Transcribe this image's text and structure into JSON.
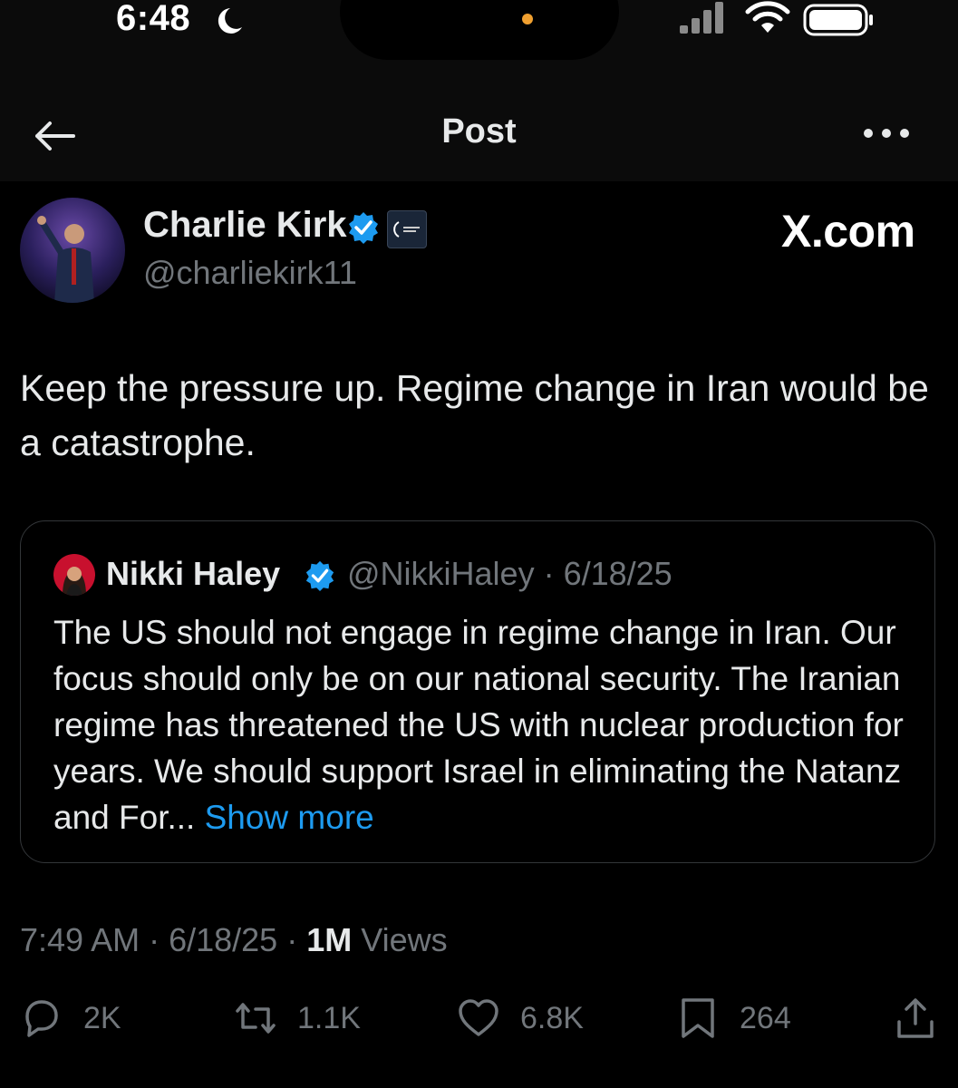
{
  "status_bar": {
    "time": "6:48"
  },
  "nav": {
    "title": "Post"
  },
  "post": {
    "author_name": "Charlie Kirk",
    "author_handle": "@charliekirk11",
    "watermark": "X.com",
    "text": "Keep the pressure up. Regime change in Iran would be a catastrophe."
  },
  "quote": {
    "author_name": "Nikki Haley",
    "author_handle": "@NikkiHaley",
    "separator": " · ",
    "date": "6/18/25",
    "text": "The US should not engage in regime change in Iran. Our focus should only be on our national security. The Iranian regime has threatened the US with nuclear production for years. We should support Israel in eliminating the Natanz and For...",
    "show_more": "Show more"
  },
  "meta": {
    "time": "7:49 AM",
    "separator": " · ",
    "date": "6/18/25",
    "views_count": "1M",
    "views_label": "Views"
  },
  "actions": {
    "replies": "2K",
    "reposts": "1.1K",
    "likes": "6.8K",
    "bookmarks": "264"
  },
  "colors": {
    "background": "#000000",
    "text": "#e7e9ea",
    "secondary": "#71767b",
    "link": "#1d9bf0",
    "verified": "#1d9bf0"
  }
}
